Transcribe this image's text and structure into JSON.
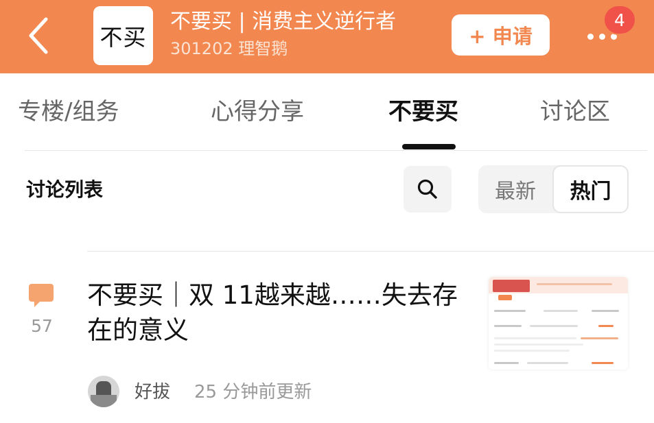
{
  "colors": {
    "accent": "#f2874f",
    "badge": "#f0524a",
    "active_tab": "#111111",
    "muted": "#999999"
  },
  "header": {
    "back_icon": "chevron-left-icon",
    "logo_text": "不买",
    "title": "不要买 | 消费主义逆行者",
    "subtitle": "301202 理智鹅",
    "apply_label": "+ 申请",
    "more_icon": "more-dots-icon",
    "notification_count": "4"
  },
  "tabs": [
    {
      "label": "专楼/组务",
      "active": false
    },
    {
      "label": "心得分享",
      "active": false
    },
    {
      "label": "不要买",
      "active": true
    },
    {
      "label": "讨论区",
      "active": false
    }
  ],
  "list": {
    "title": "讨论列表",
    "search_icon": "search-icon",
    "sort_options": [
      "最新",
      "热门"
    ],
    "selected_sort": "热门"
  },
  "posts": [
    {
      "comment_icon": "comment-bubble-icon",
      "comment_count": "57",
      "title": "不要买｜双 11越来越……失去存在的意义",
      "author": "好拔",
      "updated": "25 分钟前更新"
    }
  ]
}
